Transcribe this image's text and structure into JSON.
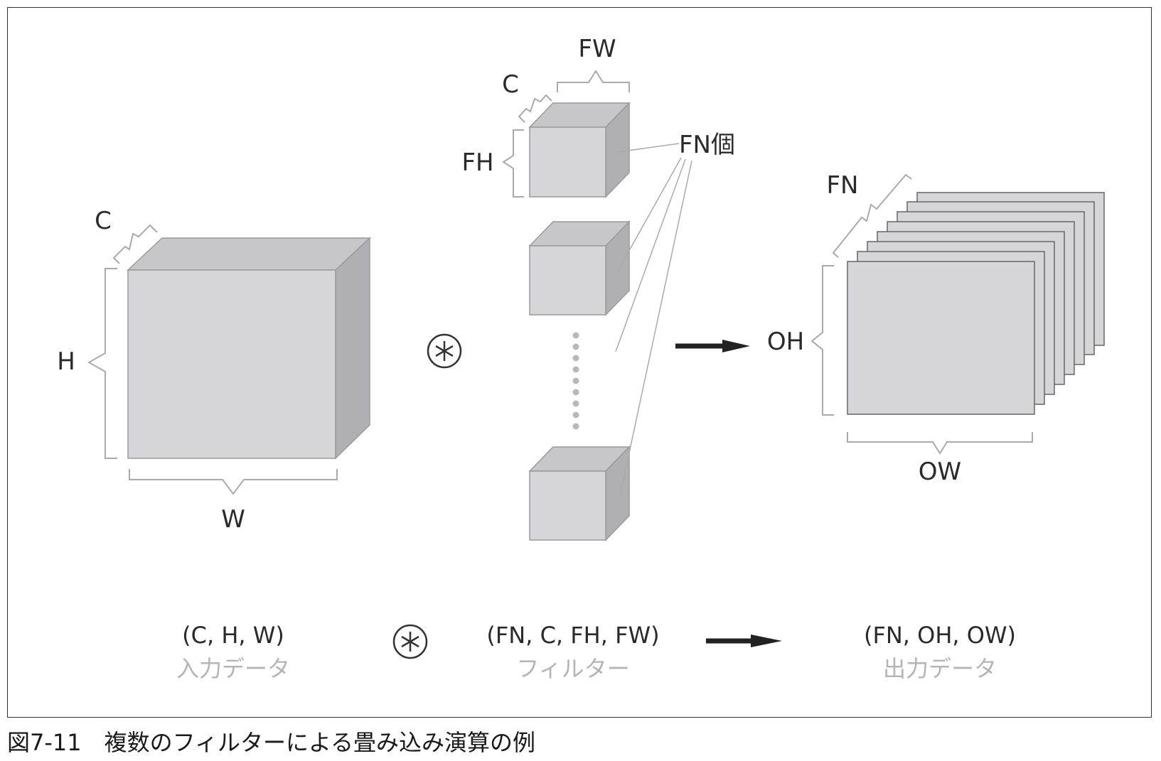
{
  "input": {
    "label_c": "C",
    "label_h": "H",
    "label_w": "W",
    "formula": "(C, H, W)",
    "name": "入力データ"
  },
  "filter": {
    "label_c": "C",
    "label_fw": "FW",
    "label_fh": "FH",
    "count_label": "FN個",
    "formula": "(FN, C, FH, FW)",
    "name": "フィルター"
  },
  "output": {
    "label_fn": "FN",
    "label_oh": "OH",
    "label_ow": "OW",
    "formula": "(FN, OH, OW)",
    "name": "出力データ"
  },
  "caption": "図7-11　複数のフィルターによる畳み込み演算の例"
}
